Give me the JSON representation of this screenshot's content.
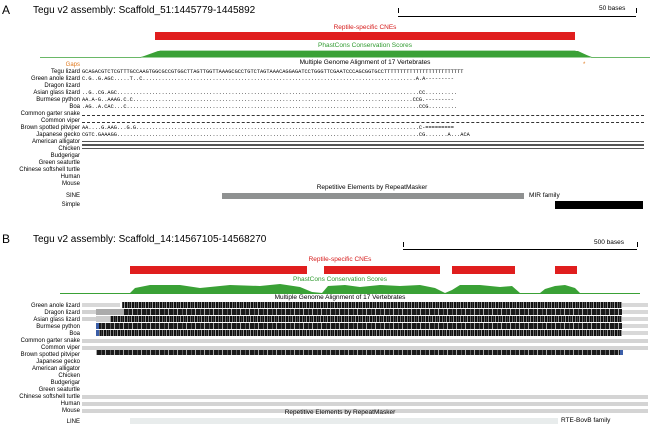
{
  "panel_a": {
    "letter": "A",
    "title": "Tegu v2 assembly:  Scaffold_51:1445779-1445892",
    "scale": "50 bases",
    "cne_label": "Reptile-specific CNEs",
    "phast_label": "PhastCons Conservation Scores",
    "maf_label": "Multiple Genome Alignment of 17 Vertebrates",
    "gaps_label": "Gaps",
    "species": [
      "Tegu lizard",
      "Green anole lizard",
      "Dragon lizard",
      "Asian glass lizard",
      "Burmese python",
      "Boa",
      "Common garter snake",
      "Common viper",
      "Brown spotted pitviper",
      "Japanese gecko",
      "American alligator",
      "Chicken",
      "Budgerigar",
      "Green seaturtle",
      "Chinese softshell turtle",
      "Human",
      "Mouse"
    ],
    "seq_tegu": "GCAGACGTCTCGTTTGCCAAGTGGCGCCGTGGCTTAGTTGGTTAAAGCGCCTGTCTAGTAAACAGGAGATCCTGGGTTCGAATCCCAGCGGTGCCTTTTTTTTTTTTTTTTTTTTTTTTT",
    "seq_anole": "C.G..G.AGC.....T..C......................................................................................A.A---------",
    "seq_glass": "..G..CG.AGC...............................................................................................CC..........",
    "seq_python": "AA.A-G..AAAG.C.C........................................................................................CCG.---------",
    "seq_boa": ".AG..A.CAC...C............................................................................................CCG.........",
    "seq_pitviper": "AA....G.AAG...G.G.........................................................................................C-=========",
    "seq_gecko": "CGTC.GAAAGG...............................................................................................CG.......A...ACA",
    "rep_label": "Repetitive Elements by RepeatMasker",
    "rep_classes": [
      "SINE",
      "Simple"
    ],
    "family": "MIR family"
  },
  "panel_b": {
    "letter": "B",
    "title": "Tegu v2 assembly:  Scaffold_14:14567105-14568270",
    "scale": "500 bases",
    "cne_label": "Reptile-specific CNEs",
    "phast_label": "PhastCons Conservation Scores",
    "maf_label": "Multiple Genome Alignment of 17 Vertebrates",
    "species": [
      "Green anole lizard",
      "Dragon lizard",
      "Asian glass lizard",
      "Burmese python",
      "Boa",
      "Common garter snake",
      "Common viper",
      "Brown spotted pitviper",
      "Japanese gecko",
      "American alligator",
      "Chicken",
      "Budgerigar",
      "Green seaturtle",
      "Chinese softshell turtle",
      "Human",
      "Mouse"
    ],
    "rep_label": "Repetitive Elements by RepeatMasker",
    "rep_classes": [
      "LINE"
    ],
    "family": "RTE-BovB family"
  },
  "colors": {
    "cne": "#e01e1e",
    "phast": "#3aa136",
    "repeat_sine": "#8f9191",
    "repeat_simple": "#000000",
    "repeat_line": "#e8ecec",
    "gaps": "#e07a1f"
  }
}
